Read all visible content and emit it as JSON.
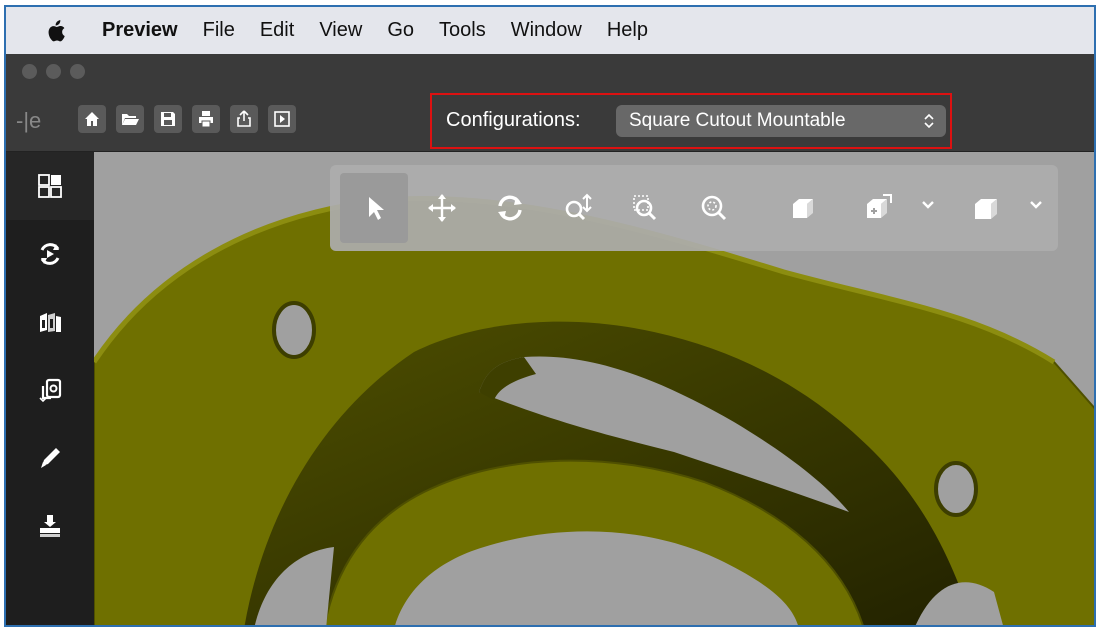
{
  "menubar": {
    "app_name": "Preview",
    "items": [
      "File",
      "Edit",
      "View",
      "Go",
      "Tools",
      "Window",
      "Help"
    ]
  },
  "toolbar": {
    "back_glyph": "-|e",
    "buttons": [
      "home-icon",
      "open-folder-icon",
      "save-icon",
      "print-icon",
      "share-icon",
      "panel-toggle-icon"
    ],
    "configurations": {
      "label": "Configurations:",
      "selected": "Square Cutout Mountable"
    }
  },
  "sidebar": {
    "items": [
      "display-manager-icon",
      "animation-icon",
      "views-icon",
      "configurations-icon",
      "markup-pen-icon",
      "print3d-icon"
    ]
  },
  "view_toolbar": {
    "tools": [
      "select-arrow-icon",
      "pan-icon",
      "rotate-icon",
      "zoom-icon",
      "zoom-area-icon",
      "zoom-fit-icon",
      "standard-view-icon",
      "view-orientation-icon",
      "display-style-icon"
    ],
    "active_tool": "select-arrow-icon"
  },
  "colors": {
    "part": "#6f7000",
    "viewport_bg": "#a0a0a0",
    "highlight": "#dd1111",
    "frame": "#2d6fb0"
  }
}
